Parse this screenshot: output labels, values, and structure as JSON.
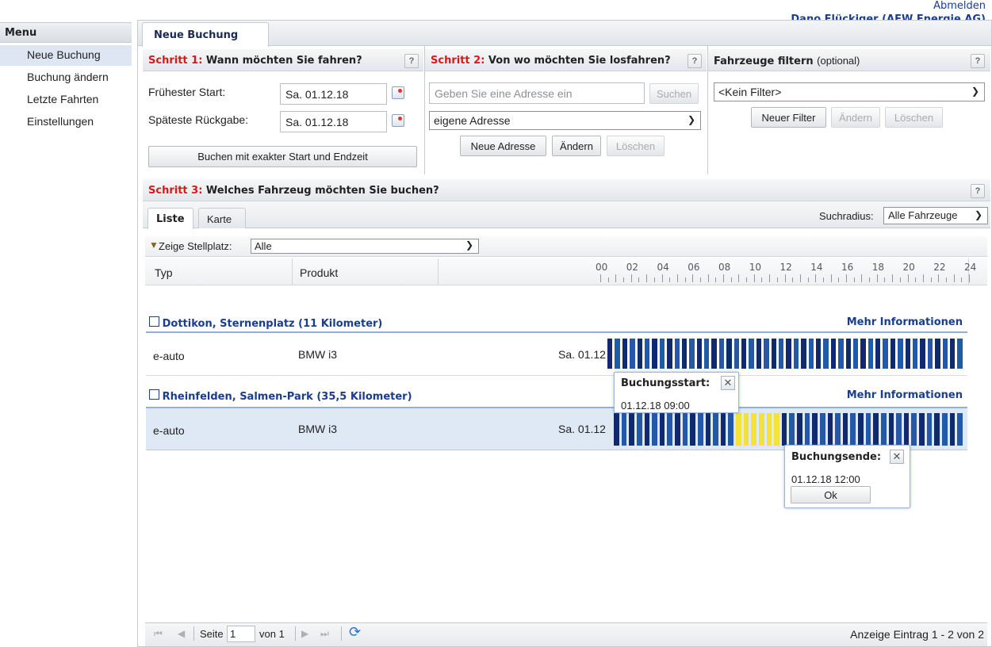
{
  "header": {
    "logout": "Abmelden",
    "user": "Dano Flückiger (AEW Energie AG)"
  },
  "menu": {
    "title": "Menu",
    "items": [
      "Neue Buchung",
      "Buchung ändern",
      "Letzte Fahrten",
      "Einstellungen"
    ]
  },
  "tabs": {
    "main": "Neue Buchung"
  },
  "step1": {
    "label": "Schritt 1:",
    "title": "Wann möchten Sie fahren?",
    "start_label": "Frühester Start:",
    "start_value": "Sa. 01.12.18",
    "return_label": "Späteste Rückgabe:",
    "return_value": "Sa. 01.12.18",
    "exact_button": "Buchen mit exakter Start und Endzeit"
  },
  "step2": {
    "label": "Schritt 2:",
    "title": "Von wo möchten Sie losfahren?",
    "address_placeholder": "Geben Sie eine Adresse ein",
    "search_button": "Suchen",
    "address_select": "eigene Adresse",
    "new_address": "Neue Adresse",
    "change": "Ändern",
    "delete": "Löschen"
  },
  "filter": {
    "title": "Fahrzeuge filtern",
    "optional": "(optional)",
    "select": "<Kein Filter>",
    "new_filter": "Neuer Filter",
    "change": "Ändern",
    "delete": "Löschen"
  },
  "help_glyph": "?",
  "step3": {
    "label": "Schritt 3:",
    "title": "Welches Fahrzeug möchten Sie buchen?",
    "tab_list": "Liste",
    "tab_map": "Karte",
    "radius_label": "Suchradius:",
    "radius_value": "Alle Fahrzeuge",
    "stellplatz_label": "Zeige Stellplatz:",
    "stellplatz_value": "Alle",
    "col_type": "Typ",
    "col_product": "Produkt",
    "hours": [
      "00",
      "02",
      "04",
      "06",
      "08",
      "10",
      "12",
      "14",
      "16",
      "18",
      "20",
      "22",
      "24"
    ],
    "more_info": "Mehr Informationen",
    "groups": [
      {
        "title": "Dottikon, Sternenplatz (11 Kilometer)",
        "vehicle": {
          "type": "e-auto",
          "product": "BMW i3",
          "date": "Sa. 01.12"
        }
      },
      {
        "title": "Rheinfelden, Salmen-Park (35,5 Kilometer)",
        "vehicle": {
          "type": "e-auto",
          "product": "BMW i3",
          "date": "Sa. 01.12"
        }
      }
    ],
    "tip_start": {
      "title": "Buchungsstart:",
      "value": "01.12.18 09:00"
    },
    "tip_end": {
      "title": "Buchungsende:",
      "value": "01.12.18 12:00",
      "ok": "Ok"
    },
    "close_glyph": "✕"
  },
  "pager": {
    "page_label": "Seite",
    "page_value": "1",
    "of": "von 1",
    "summary": "Anzeige Eintrag 1 - 2 von 2"
  },
  "colors": {
    "slot_dark": "#0f2a6e",
    "slot_mid": "#2458a8",
    "slot_selected": "#f4e23a",
    "accent": "#1a3d8f",
    "step_red": "#d61a1a"
  }
}
